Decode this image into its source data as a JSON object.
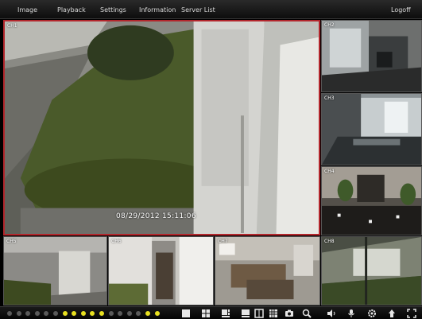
{
  "menu": {
    "image": "Image",
    "playback": "Playback",
    "settings": "Settings",
    "information": "Information",
    "server_list": "Server List",
    "logoff": "Logoff"
  },
  "cameras": {
    "ch1": {
      "label": "CH1",
      "timestamp": "08/29/2012 15:11:06"
    },
    "ch2": {
      "label": "CH2"
    },
    "ch3": {
      "label": "CH3"
    },
    "ch4": {
      "label": "CH4"
    },
    "ch5": {
      "label": "CH5"
    },
    "ch6": {
      "label": "CH6"
    },
    "ch7": {
      "label": "CH7"
    },
    "ch8": {
      "label": "CH8"
    }
  },
  "channel_indicators": [
    {
      "channel": 1,
      "color": "#5a5a5a"
    },
    {
      "channel": 2,
      "color": "#5a5a5a"
    },
    {
      "channel": 3,
      "color": "#5a5a5a"
    },
    {
      "channel": 4,
      "color": "#5a5a5a"
    },
    {
      "channel": 5,
      "color": "#5a5a5a"
    },
    {
      "channel": 6,
      "color": "#5a5a5a"
    },
    {
      "channel": 7,
      "color": "#e8e020"
    },
    {
      "channel": 8,
      "color": "#e8e020"
    },
    {
      "channel": 9,
      "color": "#e8e020"
    },
    {
      "channel": 10,
      "color": "#e8e020"
    },
    {
      "channel": 11,
      "color": "#e8e020"
    },
    {
      "channel": 12,
      "color": "#5a5a5a"
    },
    {
      "channel": 13,
      "color": "#5a5a5a"
    },
    {
      "channel": 14,
      "color": "#5a5a5a"
    },
    {
      "channel": 15,
      "color": "#5a5a5a"
    },
    {
      "channel": 16,
      "color": "#e8e020"
    },
    {
      "channel": 17,
      "color": "#e8e020"
    }
  ],
  "toolbar_icons": [
    "layout-1-icon",
    "layout-4-icon",
    "layout-6-icon",
    "layout-8-icon",
    "layout-9-icon",
    "layout-16-icon",
    "camera-snapshot-icon",
    "ptz-icon",
    "speaker-icon",
    "microphone-icon",
    "settings-icon",
    "fullscreen-toggle-icon",
    "expand-icon"
  ],
  "colors": {
    "selected_border": "#b3262c",
    "active_indicator": "#e8e020",
    "inactive_indicator": "#5a5a5a"
  }
}
